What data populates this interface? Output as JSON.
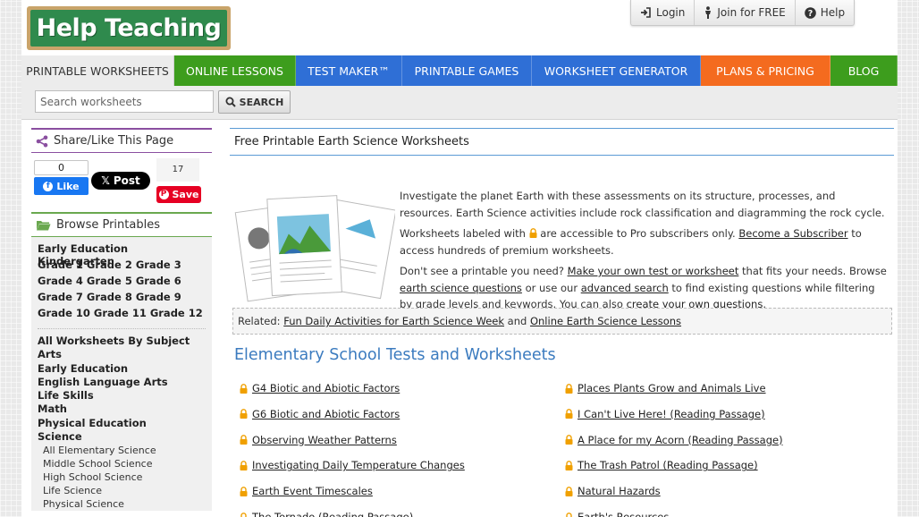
{
  "logo": {
    "text": "Help Teaching"
  },
  "toplinks": [
    {
      "label": "Login",
      "icon": "login-icon"
    },
    {
      "label": "Join for FREE",
      "icon": "person-icon"
    },
    {
      "label": "Help",
      "icon": "question-icon"
    }
  ],
  "nav": [
    {
      "label": "PRINTABLE WORKSHEETS",
      "color": "#ececec"
    },
    {
      "label": "ONLINE LESSONS",
      "color": "#3d9d1d"
    },
    {
      "label": "TEST MAKER™",
      "color": "#2f6fd6"
    },
    {
      "label": "PRINTABLE GAMES",
      "color": "#2f6fd6"
    },
    {
      "label": "WORKSHEET GENERATOR",
      "color": "#2f6fd6"
    },
    {
      "label": "PLANS & PRICING",
      "color": "#f46b1f"
    },
    {
      "label": "BLOG",
      "color": "#3d9d1d"
    }
  ],
  "search": {
    "placeholder": "Search worksheets",
    "button_label": "SEARCH"
  },
  "sidebar": {
    "share_title": "Share/Like This Page",
    "fb_count": "0",
    "fb_like": "Like",
    "post_label": "Post",
    "pin_count": "17",
    "pin_save": "Save",
    "browse_title": "Browse Printables",
    "grades": [
      "Early Education Kindergarten",
      "Grade 1 Grade 2 Grade 3",
      "Grade 4 Grade 5 Grade 6",
      "Grade 7 Grade 8 Grade 9",
      "Grade 10 Grade 11 Grade 12"
    ],
    "subjects": [
      "All Worksheets By Subject",
      "Arts",
      "Early Education",
      "English Language Arts",
      "Life Skills",
      "Math",
      "Physical Education",
      "Science"
    ],
    "science_subs": [
      "All Elementary Science",
      "Middle School Science",
      "High School Science",
      "Life Science",
      "Physical Science"
    ]
  },
  "main": {
    "title": "Free Printable Earth Science Worksheets",
    "intro_p1": "Investigate the planet Earth with these assessments on its structure, processes, and resources. Earth Science activities include rock classification and diagramming the rock cycle.",
    "intro_p2_a": "Worksheets labeled with",
    "intro_p2_b": "are accessible to Pro subscribers only.",
    "intro_p2_link": "Become a Subscriber",
    "intro_p2_c": "to access hundreds of premium worksheets.",
    "intro_p3_a": "Don't see a printable you need?",
    "intro_p3_link1": "Make your own test or worksheet",
    "intro_p3_b": "that fits your needs. Browse",
    "intro_p3_link2": "earth science questions",
    "intro_p3_c": "or use our",
    "intro_p3_link3": "advanced search",
    "intro_p3_d": "to find existing questions while filtering by grade levels and keywords. You can also",
    "intro_p3_link4": "create your own questions",
    "intro_p3_e": ".",
    "related_label": "Related:",
    "related_link1": "Fun Daily Activities for Earth Science Week",
    "related_and": "and",
    "related_link2": "Online Earth Science Lessons",
    "section_title": "Elementary School Tests and Worksheets",
    "worksheets_left": [
      "G4 Biotic and Abiotic Factors",
      "G6 Biotic and Abiotic Factors",
      "Observing Weather Patterns",
      "Investigating Daily Temperature Changes",
      "Earth Event Timescales",
      "The Tornado (Reading Passage)"
    ],
    "worksheets_right": [
      "Places Plants Grow and Animals Live",
      "I Can't Live Here! (Reading Passage)",
      "A Place for my Acorn (Reading Passage)",
      "The Trash Patrol (Reading Passage)",
      "Natural Hazards",
      "Earth's Resources"
    ]
  }
}
